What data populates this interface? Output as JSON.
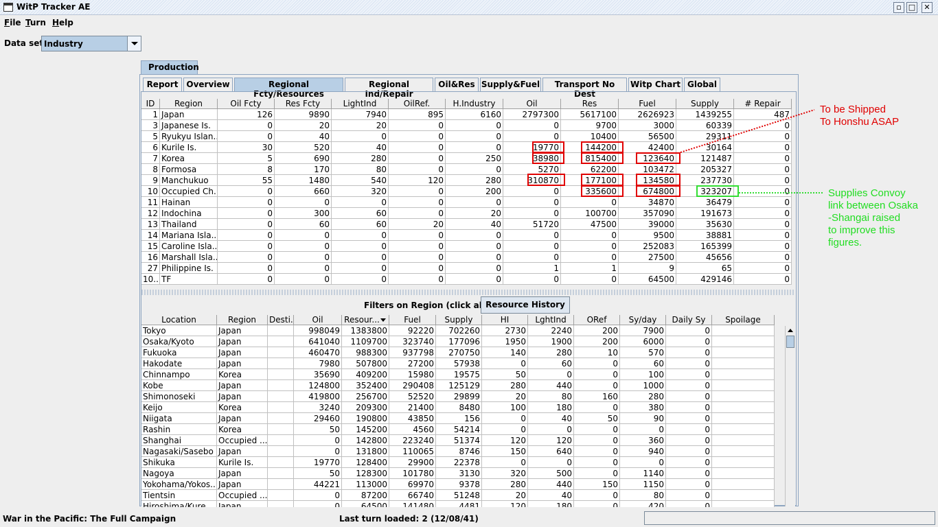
{
  "app": {
    "title": "WitP Tracker AE"
  },
  "menu": [
    {
      "label": "File",
      "u": "F",
      "rest": "ile"
    },
    {
      "label": "Turn",
      "u": "T",
      "rest": "urn"
    },
    {
      "label": "Help",
      "u": "H",
      "rest": "elp"
    }
  ],
  "dataset": {
    "label": "Data set:",
    "value": "Industry"
  },
  "outer_tab": "Production",
  "tabs": [
    "Report",
    "Overview",
    "Regional Fcty/Resources",
    "Regional Ind/Repair",
    "Oil&Res",
    "Supply&Fuel",
    "Transport No Dest",
    "Witp Chart",
    "Global"
  ],
  "selected_tab": "Regional Fcty/Resources",
  "upper": {
    "columns": [
      "ID",
      "Region",
      "Oil Fcty",
      "Res Fcty",
      "LightInd",
      "OilRef.",
      "H.Industry",
      "Oil",
      "Res",
      "Fuel",
      "Supply",
      "# Repair"
    ],
    "rows": [
      [
        "1",
        "Japan",
        "126",
        "9890",
        "7940",
        "895",
        "6160",
        "2797300",
        "5617100",
        "2626923",
        "1439255",
        "487"
      ],
      [
        "3",
        "Japanese Is.",
        "0",
        "20",
        "20",
        "0",
        "0",
        "0",
        "9700",
        "3000",
        "60339",
        "0"
      ],
      [
        "5",
        "Ryukyu Islan...",
        "0",
        "40",
        "0",
        "0",
        "0",
        "0",
        "10400",
        "56500",
        "29311",
        "0"
      ],
      [
        "6",
        "Kurile Is.",
        "30",
        "520",
        "40",
        "0",
        "0",
        "19770",
        "144200",
        "42400",
        "30164",
        "0"
      ],
      [
        "7",
        "Korea",
        "5",
        "690",
        "280",
        "0",
        "250",
        "38980",
        "815400",
        "123640",
        "121487",
        "0"
      ],
      [
        "8",
        "Formosa",
        "8",
        "170",
        "80",
        "0",
        "0",
        "5270",
        "62200",
        "103472",
        "205327",
        "0"
      ],
      [
        "9",
        "Manchukuo",
        "55",
        "1480",
        "540",
        "120",
        "280",
        "310870",
        "177100",
        "134580",
        "237730",
        "0"
      ],
      [
        "10",
        "Occupied Ch...",
        "0",
        "660",
        "320",
        "0",
        "200",
        "0",
        "335600",
        "674800",
        "323207",
        "0"
      ],
      [
        "11",
        "Hainan",
        "0",
        "0",
        "0",
        "0",
        "0",
        "0",
        "0",
        "34870",
        "36479",
        "0"
      ],
      [
        "12",
        "Indochina",
        "0",
        "300",
        "60",
        "0",
        "20",
        "0",
        "100700",
        "357090",
        "191673",
        "0"
      ],
      [
        "13",
        "Thailand",
        "0",
        "60",
        "60",
        "20",
        "40",
        "51720",
        "47500",
        "39000",
        "35630",
        "0"
      ],
      [
        "14",
        "Mariana Isla...",
        "0",
        "0",
        "0",
        "0",
        "0",
        "0",
        "0",
        "9500",
        "38881",
        "0"
      ],
      [
        "15",
        "Caroline Isla...",
        "0",
        "0",
        "0",
        "0",
        "0",
        "0",
        "0",
        "252083",
        "165399",
        "0"
      ],
      [
        "16",
        "Marshall Isla...",
        "0",
        "0",
        "0",
        "0",
        "0",
        "0",
        "0",
        "27500",
        "45656",
        "0"
      ],
      [
        "27",
        "Philippine Is.",
        "0",
        "0",
        "0",
        "0",
        "0",
        "1",
        "1",
        "9",
        "65",
        "0"
      ],
      [
        "10...",
        "TF",
        "0",
        "0",
        "0",
        "0",
        "0",
        "0",
        "0",
        "64500",
        "429146",
        "0"
      ]
    ]
  },
  "filters_label": "Filters on Region (click above)",
  "history_button": "Resource History",
  "lower": {
    "columns": [
      "Location",
      "Region",
      "Desti...",
      "Oil",
      "Resour...",
      "Fuel",
      "Supply",
      "HI",
      "LghtInd",
      "ORef",
      "Sy/day",
      "Daily Sy",
      "Spoilage"
    ],
    "rows": [
      [
        "Tokyo",
        "Japan",
        "",
        "998049",
        "1383800",
        "92220",
        "702260",
        "2730",
        "2240",
        "200",
        "7900",
        "0",
        ""
      ],
      [
        "Osaka/Kyoto",
        "Japan",
        "",
        "641040",
        "1109700",
        "323740",
        "177096",
        "1950",
        "1900",
        "200",
        "6000",
        "0",
        ""
      ],
      [
        "Fukuoka",
        "Japan",
        "",
        "460470",
        "988300",
        "937798",
        "270750",
        "140",
        "280",
        "10",
        "570",
        "0",
        ""
      ],
      [
        "Hakodate",
        "Japan",
        "",
        "7980",
        "507800",
        "27200",
        "57938",
        "0",
        "60",
        "0",
        "60",
        "0",
        ""
      ],
      [
        "Chinnampo",
        "Korea",
        "",
        "35690",
        "409200",
        "15980",
        "19575",
        "50",
        "0",
        "0",
        "100",
        "0",
        ""
      ],
      [
        "Kobe",
        "Japan",
        "",
        "124800",
        "352400",
        "290408",
        "125129",
        "280",
        "440",
        "0",
        "1000",
        "0",
        ""
      ],
      [
        "Shimonoseki",
        "Japan",
        "",
        "419800",
        "256700",
        "52520",
        "29899",
        "20",
        "80",
        "160",
        "280",
        "0",
        ""
      ],
      [
        "Keijo",
        "Korea",
        "",
        "3240",
        "209300",
        "21400",
        "8480",
        "100",
        "180",
        "0",
        "380",
        "0",
        ""
      ],
      [
        "Niigata",
        "Japan",
        "",
        "29460",
        "190800",
        "43850",
        "156",
        "0",
        "40",
        "50",
        "90",
        "0",
        ""
      ],
      [
        "Rashin",
        "Korea",
        "",
        "50",
        "145200",
        "4560",
        "54214",
        "0",
        "0",
        "0",
        "0",
        "0",
        ""
      ],
      [
        "Shanghai",
        "Occupied ...",
        "",
        "0",
        "142800",
        "223240",
        "51374",
        "120",
        "120",
        "0",
        "360",
        "0",
        ""
      ],
      [
        "Nagasaki/Sasebo",
        "Japan",
        "",
        "0",
        "131800",
        "110065",
        "8746",
        "150",
        "640",
        "0",
        "940",
        "0",
        ""
      ],
      [
        "Shikuka",
        "Kurile Is.",
        "",
        "19770",
        "128400",
        "29900",
        "22378",
        "0",
        "0",
        "0",
        "0",
        "0",
        ""
      ],
      [
        "Nagoya",
        "Japan",
        "",
        "50",
        "128300",
        "101780",
        "3130",
        "320",
        "500",
        "0",
        "1140",
        "0",
        ""
      ],
      [
        "Yokohama/Yokos...",
        "Japan",
        "",
        "44221",
        "113000",
        "69970",
        "9378",
        "280",
        "440",
        "150",
        "1150",
        "0",
        ""
      ],
      [
        "Tientsin",
        "Occupied ...",
        "",
        "0",
        "87200",
        "66740",
        "51248",
        "20",
        "40",
        "0",
        "80",
        "0",
        ""
      ],
      [
        "Hiroshima/Kure",
        "Japan",
        "",
        "0",
        "64500",
        "141480",
        "4481",
        "120",
        "180",
        "0",
        "420",
        "0",
        ""
      ]
    ]
  },
  "annotations": {
    "red": [
      "To be Shipped",
      "To Honshu ASAP"
    ],
    "green": [
      "Supplies Convoy",
      "link between Osaka",
      "-Shangai raised",
      "to improve this",
      "figures."
    ]
  },
  "colors": {
    "highlight_red": "#e00000",
    "highlight_green": "#33dd33",
    "selected_tab": "#b8cfe5"
  },
  "status": {
    "left": "War in the Pacific: The Full Campaign",
    "middle": "Last turn loaded: 2 (12/08/41)"
  }
}
